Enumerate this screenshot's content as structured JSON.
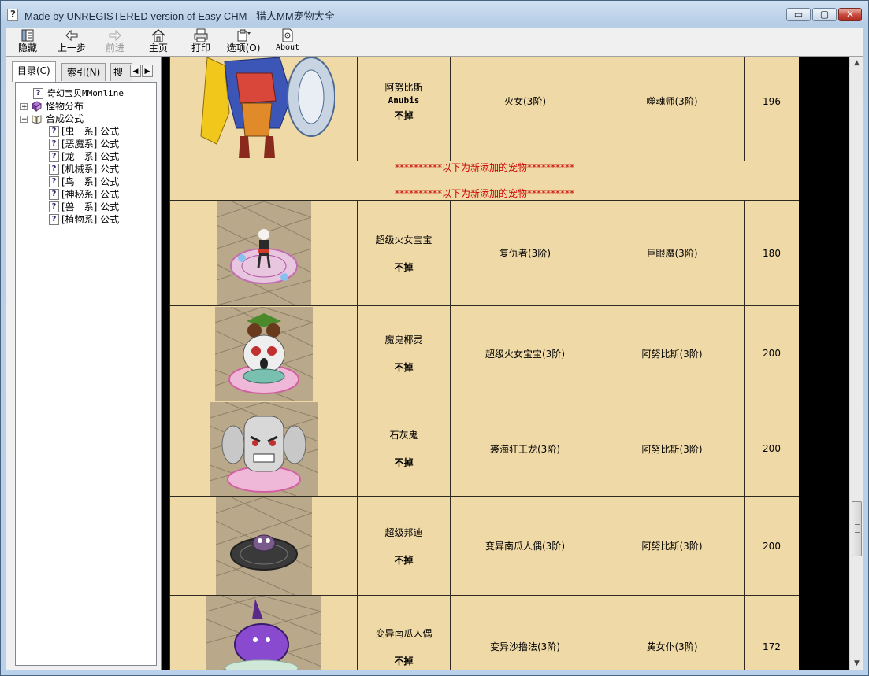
{
  "window": {
    "title": "Made by UNREGISTERED version of Easy CHM - 猎人MM宠物大全",
    "icon": "help-file-icon",
    "controls": {
      "minimize": "▭",
      "maximize": "▢",
      "close": "✕"
    }
  },
  "toolbar": {
    "hide": "隐藏",
    "back": "上一步",
    "forward": "前进",
    "home": "主页",
    "print": "打印",
    "options": "选项(O)",
    "about": "About"
  },
  "left_pane": {
    "tabs": [
      "目录(C)",
      "索引(N)",
      "搜索"
    ],
    "tree": {
      "root": "奇幻宝贝MMonline",
      "monster_dist": "怪物分布",
      "synth": "合成公式",
      "children": [
        "[虫　系] 公式",
        "[恶魔系] 公式",
        "[龙　系] 公式",
        "[机械系] 公式",
        "[鸟　系] 公式",
        "[神秘系] 公式",
        "[兽　系] 公式",
        "[植物系] 公式"
      ]
    }
  },
  "table": {
    "anubis": {
      "name": "阿努比斯",
      "en": "Anubis",
      "drop": "不掉",
      "a": "火女(3阶)",
      "b": "噬魂师(3阶)",
      "lv": "196"
    },
    "banner_top": "**********以下为新添加的宠物**********",
    "banner_bottom": "**********以下为新添加的宠物**********",
    "rows": [
      {
        "name": "超级火女宝宝",
        "drop": "不掉",
        "a": "复仇者(3阶)",
        "b": "巨眼魔(3阶)",
        "lv": "180"
      },
      {
        "name": "魔鬼椰灵",
        "drop": "不掉",
        "a": "超级火女宝宝(3阶)",
        "b": "阿努比斯(3阶)",
        "lv": "200"
      },
      {
        "name": "石灰鬼",
        "drop": "不掉",
        "a": "裘海狂王龙(3阶)",
        "b": "阿努比斯(3阶)",
        "lv": "200"
      },
      {
        "name": "超级邦迪",
        "drop": "不掉",
        "a": "变异南瓜人偶(3阶)",
        "b": "阿努比斯(3阶)",
        "lv": "200"
      },
      {
        "name": "变异南瓜人偶",
        "drop": "不掉",
        "a": "变异沙撸法(3阶)",
        "b": "黄女仆(3阶)",
        "lv": "172"
      }
    ]
  },
  "scrollbar": {
    "up": "▲",
    "down": "▼"
  }
}
